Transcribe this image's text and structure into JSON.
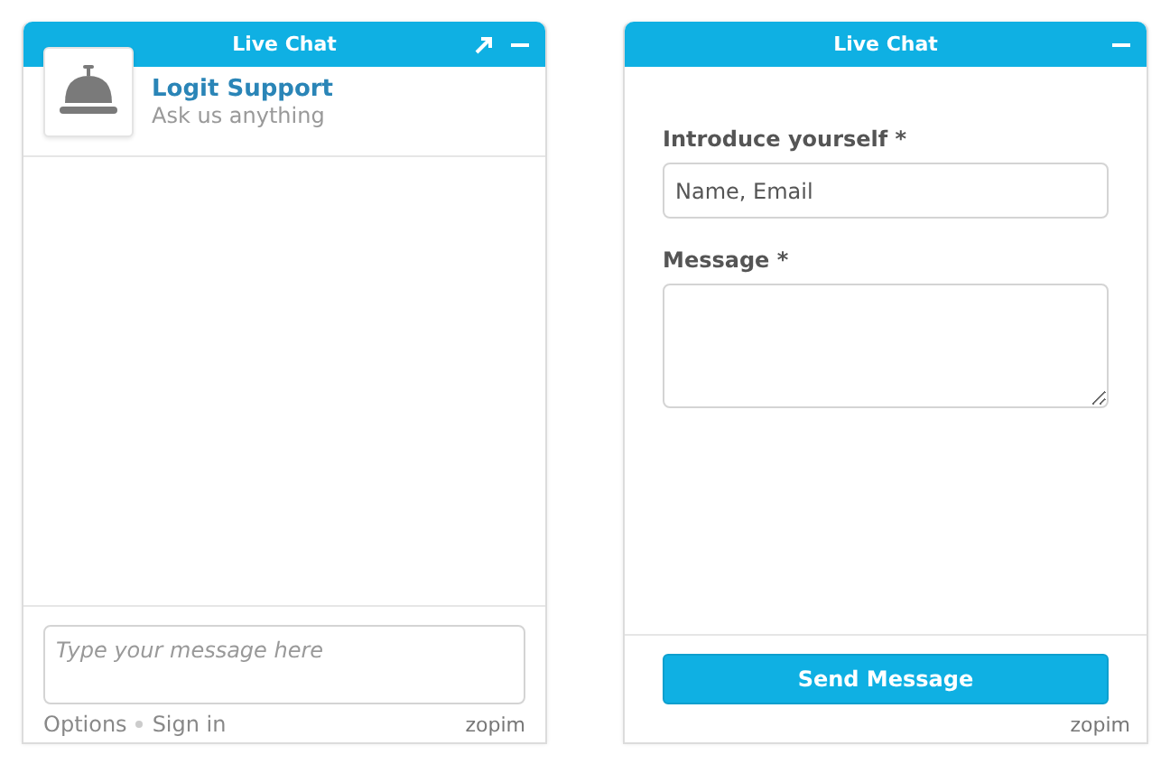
{
  "chat_window": {
    "title": "Live Chat",
    "agent": {
      "name": "Logit Support",
      "tagline": "Ask us anything"
    },
    "input": {
      "placeholder": "Type your message here"
    },
    "footer_links": [
      "Options",
      "Sign in"
    ],
    "brand": "zopim"
  },
  "offline_form": {
    "title": "Live Chat",
    "fields": [
      {
        "label": "Introduce yourself *",
        "kind": "input",
        "placeholder": "Name, Email"
      },
      {
        "label": "Message *",
        "kind": "textarea"
      }
    ],
    "submit": "Send Message",
    "brand": "zopim"
  }
}
